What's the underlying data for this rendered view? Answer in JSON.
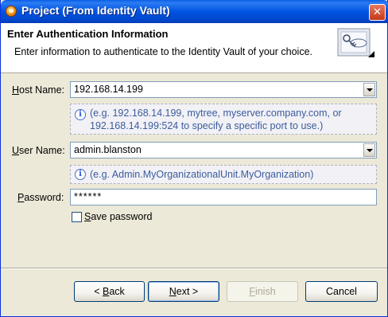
{
  "window": {
    "title": "Project (From Identity Vault)",
    "close_glyph": "✕"
  },
  "header": {
    "title": "Enter Authentication Information",
    "description": "Enter information to authenticate to the Identity Vault of your choice.",
    "icon": "wizard-banner-icon"
  },
  "form": {
    "host": {
      "label_mnemonic": "H",
      "label_rest": "ost Name:",
      "value": "192.168.14.199",
      "hint_icon": "i",
      "hint": "(e.g. 192.168.14.199, mytree, myserver.company.com, or 192.168.14.199:524 to specify a specific port to use.)"
    },
    "user": {
      "label_mnemonic": "U",
      "label_rest": "ser Name:",
      "value": "admin.blanston",
      "hint_icon": "i",
      "hint": "(e.g. Admin.MyOrganizationalUnit.MyOrganization)"
    },
    "password": {
      "label_mnemonic": "P",
      "label_rest": "assword:",
      "value": "******"
    },
    "save_password": {
      "label_mnemonic": "S",
      "label_rest": "ave password",
      "checked": false
    }
  },
  "buttons": {
    "back": {
      "prefix": "< ",
      "mnemonic": "B",
      "rest": "ack"
    },
    "next": {
      "mnemonic": "N",
      "rest": "ext >"
    },
    "finish": {
      "mnemonic": "F",
      "rest": "inish",
      "enabled": false
    },
    "cancel": {
      "label": "Cancel"
    }
  },
  "colors": {
    "titlebar": "#0054e3",
    "dialog_bg": "#ece9d8",
    "hint_text": "#3c5c9c"
  }
}
